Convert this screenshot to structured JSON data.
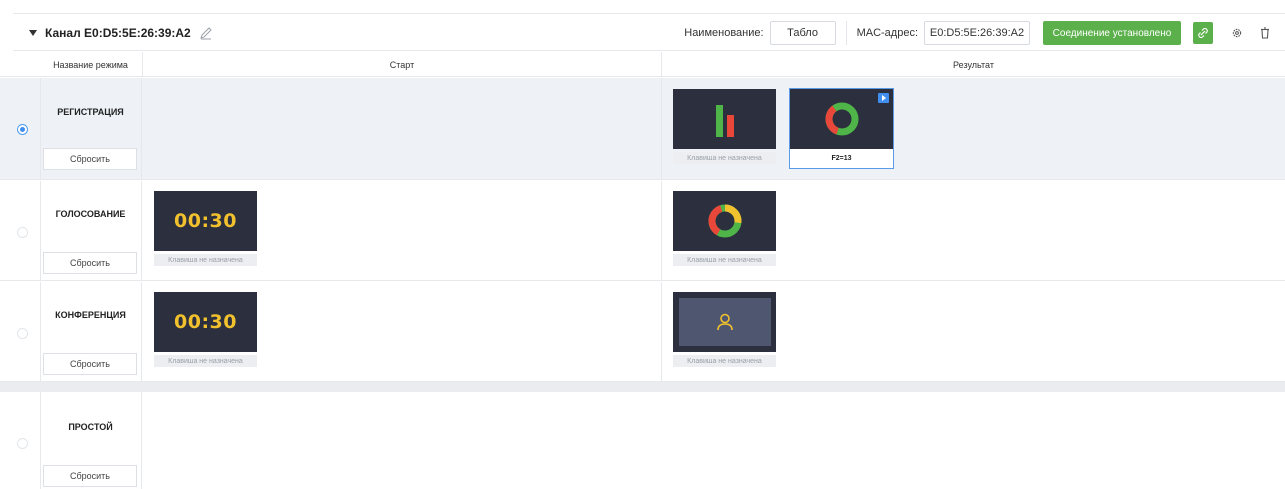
{
  "header": {
    "channel_title": "Канал E0:D5:5E:26:39:A2",
    "name_label": "Наименование:",
    "name_value": "Табло",
    "mac_label": "MAC-адрес:",
    "mac_value": "E0:D5:5E:26:39:A2",
    "connection_status": "Соединение установлено",
    "icons": [
      "caret-down-icon",
      "pencil-icon",
      "link-icon",
      "gear-icon",
      "trash-icon"
    ],
    "colors": {
      "accent_green": "#5cb04c",
      "selection_blue": "#3f8ef0",
      "screen_bg": "#2b2f3e",
      "timer_yellow": "#f2c12e"
    }
  },
  "table": {
    "columns": [
      "Название режима",
      "Старт",
      "Результат"
    ],
    "reset_label": "Сбросить",
    "unassigned_key": "Клавиша не назначена",
    "rows": [
      {
        "mode": "РЕГИСТРАЦИЯ",
        "selected": true,
        "start": [],
        "result": [
          {
            "kind": "bar-chart",
            "caption": "Клавиша не назначена"
          },
          {
            "kind": "donut-chart",
            "caption": "F2=13",
            "selected": true
          }
        ]
      },
      {
        "mode": "ГОЛОСОВАНИЕ",
        "selected": false,
        "start": [
          {
            "kind": "timer",
            "timer": "00:30",
            "caption": "Клавиша не назначена"
          }
        ],
        "result": [
          {
            "kind": "donut-chart",
            "caption": "Клавиша не назначена"
          }
        ]
      },
      {
        "mode": "КОНФЕРЕНЦИЯ",
        "selected": false,
        "start": [
          {
            "kind": "timer",
            "timer": "00:30",
            "caption": "Клавиша не назначена"
          }
        ],
        "result": [
          {
            "kind": "person",
            "caption": "Клавиша не назначена"
          }
        ]
      },
      {
        "mode": "ПРОСТОЙ",
        "selected": false,
        "start": [],
        "result": []
      }
    ]
  }
}
